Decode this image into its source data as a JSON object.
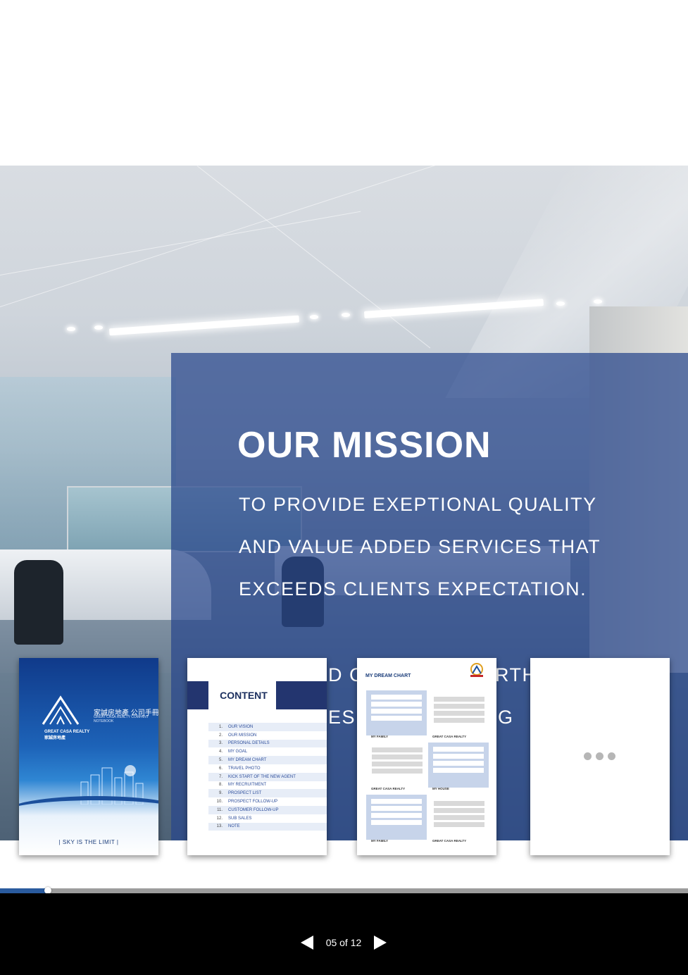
{
  "mission": {
    "title": "OUR MISSION",
    "lines": [
      "TO PROVIDE EXEPTIONAL QUALITY",
      "AND VALUE ADDED SERVICES THAT",
      "EXCEEDS CLIENTS EXPECTATION."
    ],
    "partial_line_4": [
      "D C",
      "RTH"
    ],
    "partial_line_5": [
      "ES",
      "G"
    ]
  },
  "thumbnails": {
    "cover": {
      "chinese_name": "家誠房地產 公司手冊",
      "english_lines": [
        "GREAT CASA REALTY COMPANY",
        "NOTEBOOK"
      ],
      "brand": "GREAT CASA REALTY 家誠房地產",
      "tagline": "|  SKY IS THE LIMIT  |"
    },
    "contents": {
      "heading": "CONTENT",
      "items": [
        {
          "num": "1.",
          "label": "OUR VISION"
        },
        {
          "num": "2.",
          "label": "OUR MISSION"
        },
        {
          "num": "3.",
          "label": "PERSONAL DETAILS"
        },
        {
          "num": "4.",
          "label": "MY GOAL"
        },
        {
          "num": "5.",
          "label": "MY DREAM CHART"
        },
        {
          "num": "6.",
          "label": "TRAVEL PHOTO"
        },
        {
          "num": "7.",
          "label": "KICK START OF THE NEW AGENT"
        },
        {
          "num": "8.",
          "label": "MY RECRUITMENT"
        },
        {
          "num": "9.",
          "label": "PROSPECT LIST"
        },
        {
          "num": "10.",
          "label": "PROSPECT FOLLOW-UP"
        },
        {
          "num": "11.",
          "label": "CUSTOMER FOLLOW-UP"
        },
        {
          "num": "12.",
          "label": "SUB SALES"
        },
        {
          "num": "13.",
          "label": "NOTE"
        }
      ]
    },
    "dream_chart": {
      "title": "MY DREAM CHART",
      "captions": [
        "MY FAMILY",
        "GREAT CASA REALTY",
        "GREAT CASA REALTY",
        "MY HOUSE",
        "MY FAMILY",
        "GREAT CASA REALTY"
      ]
    },
    "more": {
      "icon": "ellipsis-icon"
    }
  },
  "pager": {
    "current": "05 of 12",
    "progress": 0.07,
    "prev_icon": "triangle-left-icon",
    "next_icon": "triangle-right-icon"
  },
  "colors": {
    "overlay": "#284680",
    "accent": "#2a5b9e",
    "footer": "#000000"
  }
}
